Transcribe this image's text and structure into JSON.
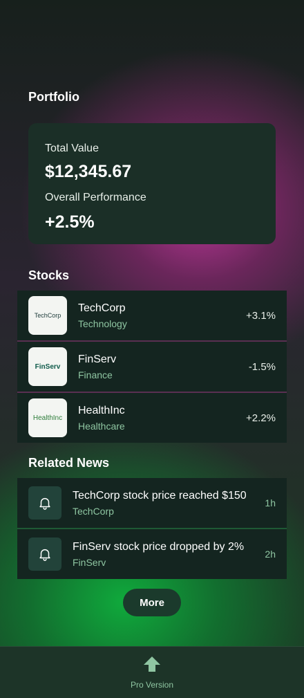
{
  "portfolio": {
    "title": "Portfolio",
    "total_value_label": "Total Value",
    "total_value": "$12,345.67",
    "performance_label": "Overall Performance",
    "performance": "+2.5%"
  },
  "stocks": {
    "title": "Stocks",
    "items": [
      {
        "logo": "TechCorp",
        "name": "TechCorp",
        "sector": "Technology",
        "change": "+3.1%"
      },
      {
        "logo": "FinServ",
        "name": "FinServ",
        "sector": "Finance",
        "change": "-1.5%"
      },
      {
        "logo": "HealthInc",
        "name": "HealthInc",
        "sector": "Healthcare",
        "change": "+2.2%"
      }
    ]
  },
  "news": {
    "title": "Related News",
    "items": [
      {
        "icon": "bell-icon",
        "headline": "TechCorp stock price reached $150",
        "source": "TechCorp",
        "time": "1h"
      },
      {
        "icon": "bell-icon",
        "headline": "FinServ stock price dropped by 2%",
        "source": "FinServ",
        "time": "2h"
      }
    ]
  },
  "more_label": "More",
  "bottom_bar": {
    "icon": "arrow-up-icon",
    "label": "Pro Version"
  },
  "colors": {
    "accent_green": "#8fc6a2",
    "card_bg": "#1b2f27",
    "row_bg": "#142520",
    "bell_bg": "#22433a"
  }
}
